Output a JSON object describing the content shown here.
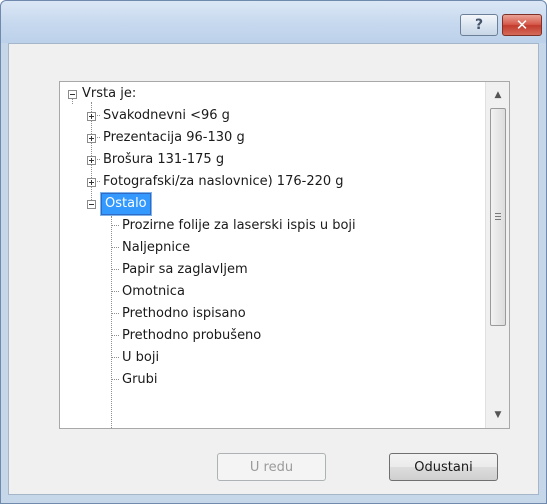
{
  "titlebar": {
    "help_label": "?",
    "close_label": "✕"
  },
  "tree": {
    "root": {
      "label": "Vrsta je:",
      "expanded": true
    },
    "groups": [
      {
        "label": "Svakodnevni <96 g",
        "expanded": false
      },
      {
        "label": "Prezentacija 96-130 g",
        "expanded": false
      },
      {
        "label": "Brošura 131-175 g",
        "expanded": false
      },
      {
        "label": "Fotografski/za naslovnice) 176-220 g",
        "expanded": false
      },
      {
        "label": "Ostalo",
        "expanded": true,
        "selected": true
      }
    ],
    "children": [
      {
        "label": "Prozirne folije za laserski ispis u boji"
      },
      {
        "label": "Naljepnice"
      },
      {
        "label": "Papir sa zaglavljem"
      },
      {
        "label": "Omotnica"
      },
      {
        "label": "Prethodno ispisano"
      },
      {
        "label": "Prethodno probušeno"
      },
      {
        "label": "U boji"
      },
      {
        "label": "Grubi"
      }
    ]
  },
  "scrollbar": {
    "up_icon": "arrow-up-icon",
    "down_icon": "arrow-down-icon",
    "position": 0
  },
  "buttons": {
    "ok_label": "U redu",
    "ok_enabled": false,
    "cancel_label": "Odustani"
  },
  "colors": {
    "selection": "#3399ff",
    "close_button": "#c23b2d",
    "frame": "#c7d7ea"
  }
}
